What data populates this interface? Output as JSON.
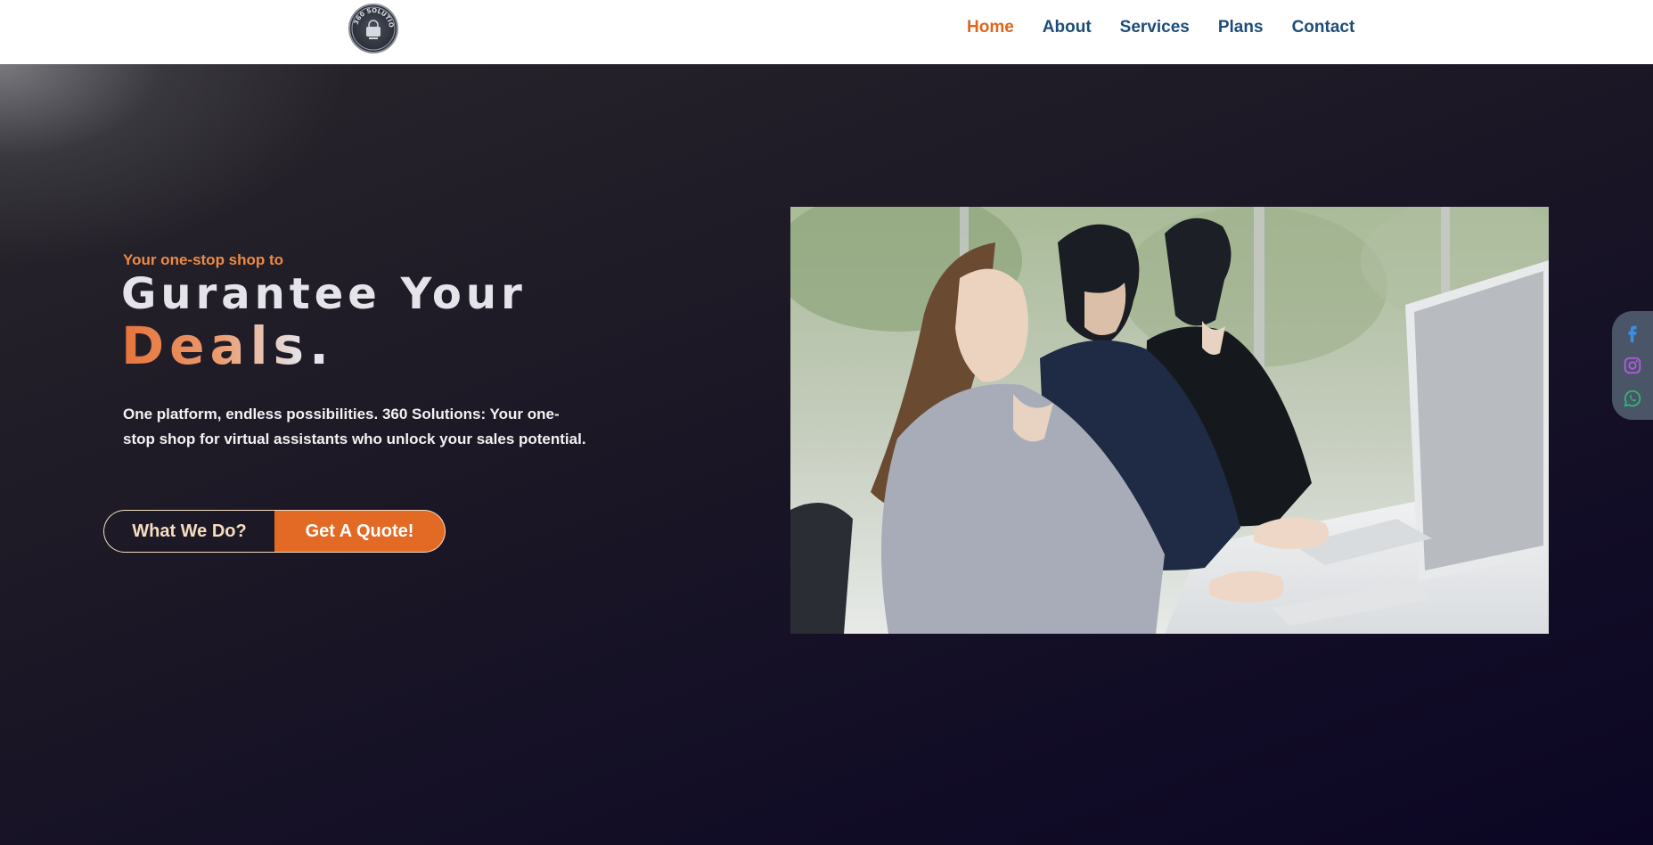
{
  "nav": {
    "logo_text": "360 SOLUTIONS",
    "items": [
      {
        "label": "Home",
        "active": true
      },
      {
        "label": "About",
        "active": false
      },
      {
        "label": "Services",
        "active": false
      },
      {
        "label": "Plans",
        "active": false
      },
      {
        "label": "Contact",
        "active": false
      }
    ]
  },
  "hero": {
    "tagline": "Your one-stop shop to",
    "headline": "Gurantee Your",
    "headline_accent": "Deals.",
    "description": "One platform, endless possibilities. 360 Solutions: Your one-stop shop for virtual assistants who unlock your sales potential.",
    "buttons": {
      "secondary": "What We Do?",
      "primary": "Get A Quote!"
    },
    "image_alt": "call-center-agents-photo"
  },
  "social": {
    "icons": [
      "facebook-icon",
      "instagram-icon",
      "whatsapp-icon"
    ]
  },
  "colors": {
    "accent": "#e26a24",
    "nav_text": "#1e4c7a",
    "nav_active": "#e0651f",
    "tagline": "#ee8a45",
    "social_facebook": "#3b8fe0",
    "social_instagram": "#b45be0",
    "social_whatsapp": "#2fb673"
  }
}
